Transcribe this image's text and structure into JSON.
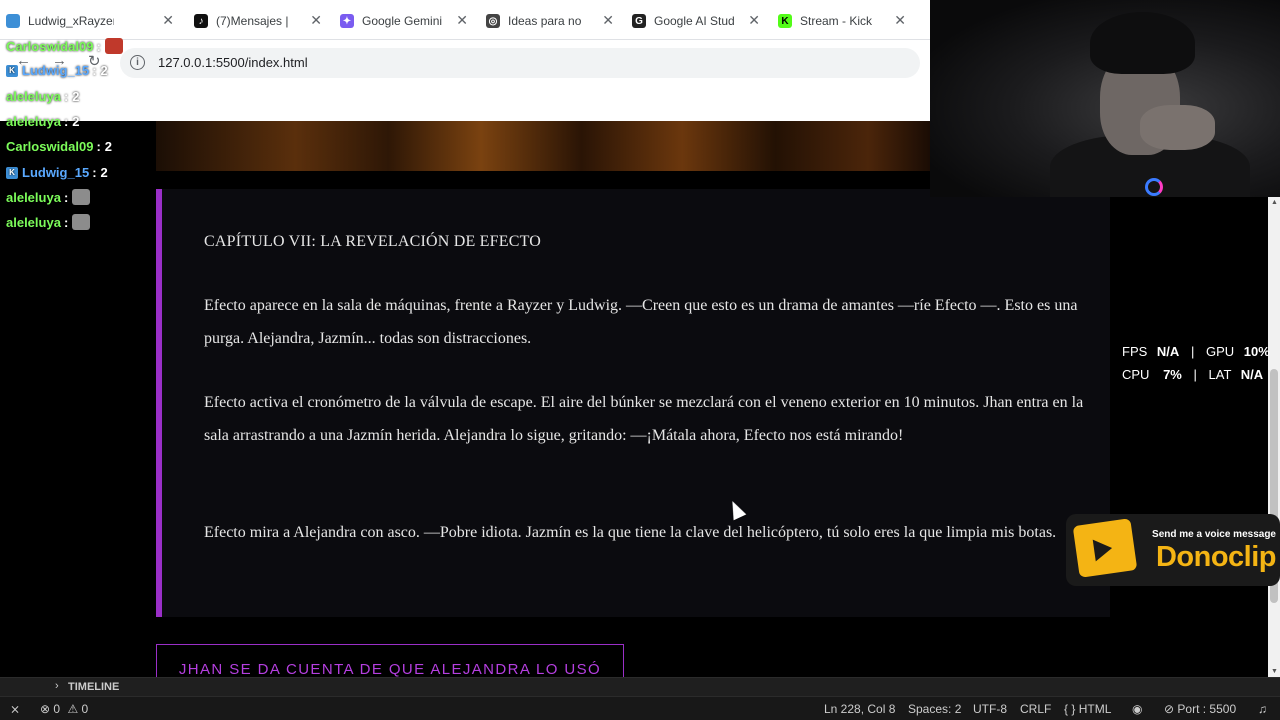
{
  "browser": {
    "tabs": [
      {
        "label": "Ludwig_xRayzerC St",
        "icon_color": "#3d8fd6"
      },
      {
        "label": "(7)Mensajes |",
        "icon_color": "#111111"
      },
      {
        "label": "Google Gemini",
        "icon_color": "#7a5cf0"
      },
      {
        "label": "Ideas para no",
        "icon_color": "#444444"
      },
      {
        "label": "Google AI Stud",
        "icon_color": "#222222"
      },
      {
        "label": "Stream - Kick",
        "icon_color": "#53fc18"
      }
    ],
    "url": "127.0.0.1:5500/index.html"
  },
  "chat": [
    {
      "user": "Carloswidal09",
      "user_color": "#7CFC5A",
      "message": "",
      "emote": true
    },
    {
      "user": "Ludwig_15",
      "user_color": "#5aa9ff",
      "message": "2",
      "badge": true
    },
    {
      "user": "aleleluya",
      "user_color": "#7CFC5A",
      "message": "2"
    },
    {
      "user": "aleleluya",
      "user_color": "#7CFC5A",
      "message": "2"
    },
    {
      "user": "Carloswidal09",
      "user_color": "#7CFC5A",
      "message": "2"
    },
    {
      "user": "Ludwig_15",
      "user_color": "#5aa9ff",
      "message": "2",
      "badge": true
    },
    {
      "user": "aleleluya",
      "user_color": "#7CFC5A",
      "message": "",
      "emote": true
    },
    {
      "user": "aleleluya",
      "user_color": "#7CFC5A",
      "message": "",
      "emote": true
    }
  ],
  "chapter": {
    "title": "CAPÍTULO VII: LA REVELACIÓN DE EFECTO",
    "paragraphs": [
      "Efecto aparece en la sala de máquinas, frente a Rayzer y Ludwig. —Creen que esto es un drama de amantes —ríe Efecto —. Esto es una purga. Alejandra, Jazmín... todas son distracciones.",
      "Efecto activa el cronómetro de la válvula de escape. El aire del búnker se mezclará con el veneno exterior en 10 minutos. Jhan entra en la sala arrastrando a una Jazmín herida. Alejandra lo sigue, gritando: —¡Mátala ahora, Efecto nos está mirando!",
      "Efecto mira a Alejandra con asco. —Pobre idiota. Jazmín es la que tiene la clave del helicóptero, tú solo eres la que limpia mis botas."
    ],
    "choice_button": "JHAN SE DA CUENTA DE QUE ALEJANDRA LO USÓ"
  },
  "stats": {
    "fps_label": "FPS",
    "fps_value": "N/A",
    "gpu_label": "GPU",
    "gpu_value": "10%",
    "cpu_label": "CPU",
    "cpu_value": "7%",
    "lat_label": "LAT",
    "lat_value": "N/A"
  },
  "donoclip": {
    "subtitle": "Send me a voice message",
    "title": "Donoclip"
  },
  "editor": {
    "timeline_label": "TIMELINE",
    "errors": "0",
    "warnings": "0",
    "position": "Ln 228, Col 8",
    "spaces": "Spaces: 2",
    "encoding": "UTF-8",
    "eol": "CRLF",
    "language": "HTML",
    "port": "Port : 5500"
  },
  "colors": {
    "accent": "#9a2fc8",
    "choice_text": "#b53fe0",
    "donoclip_yellow": "#f4b414"
  }
}
